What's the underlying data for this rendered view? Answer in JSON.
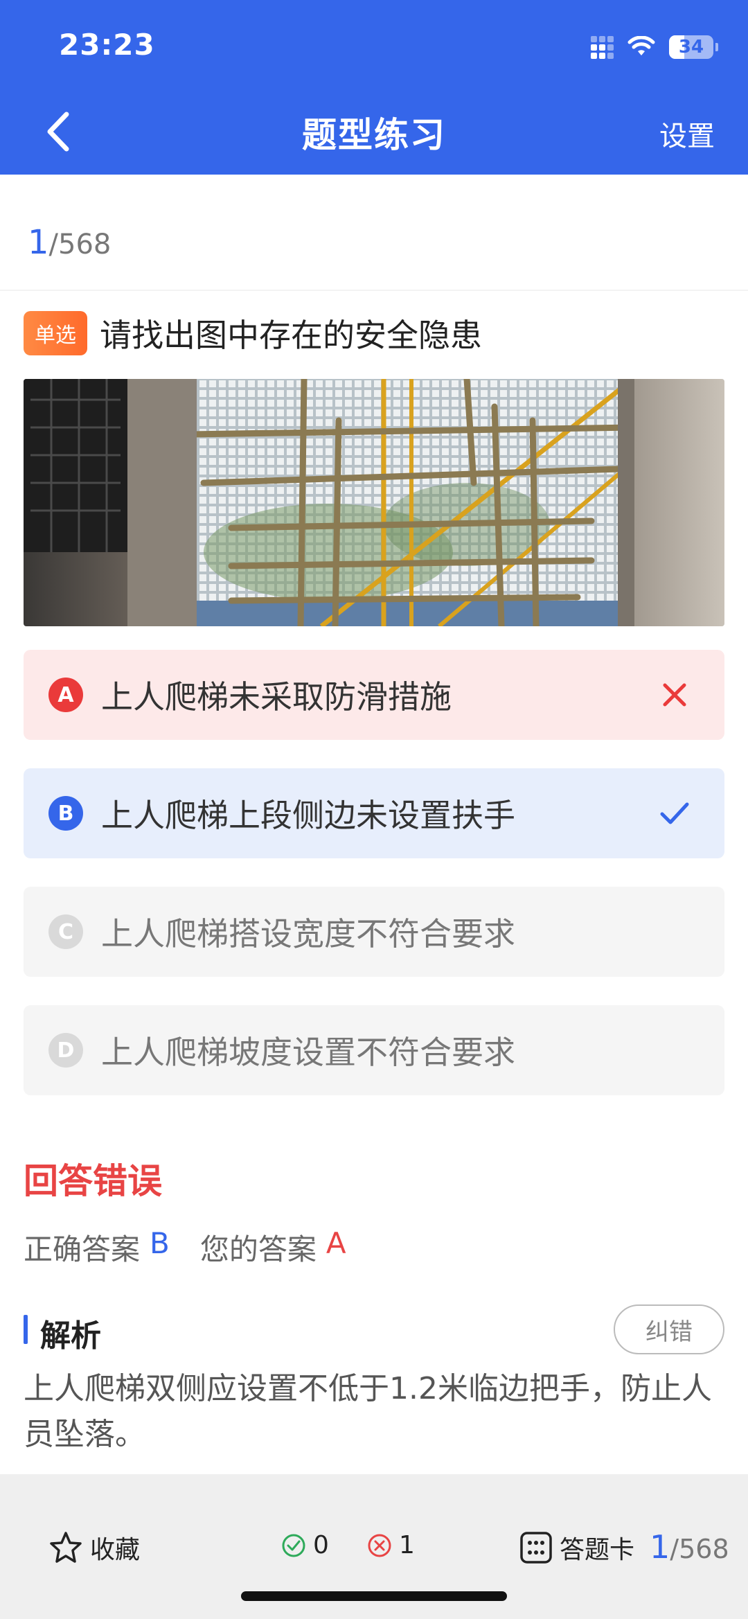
{
  "status": {
    "time": "23:23",
    "battery": "34"
  },
  "header": {
    "title": "题型练习",
    "settings_label": "设置"
  },
  "counter": {
    "current": "1",
    "total": "/568"
  },
  "question": {
    "type_badge": "单选",
    "text": "请找出图中存在的安全隐患"
  },
  "options": [
    {
      "letter": "A",
      "text": "上人爬梯未采取防滑措施",
      "state": "wrong"
    },
    {
      "letter": "B",
      "text": "上人爬梯上段侧边未设置扶手",
      "state": "correct"
    },
    {
      "letter": "C",
      "text": "上人爬梯搭设宽度不符合要求",
      "state": "normal"
    },
    {
      "letter": "D",
      "text": "上人爬梯坡度设置不符合要求",
      "state": "normal"
    }
  ],
  "result": {
    "title": "回答错误",
    "correct_label": "正确答案",
    "correct_answer": "B",
    "your_label": "您的答案",
    "your_answer": "A"
  },
  "analysis": {
    "title": "解析",
    "report_label": "纠错",
    "text": "上人爬梯双侧应设置不低于1.2米临边把手，防止人员坠落。"
  },
  "bottom": {
    "favorite_label": "收藏",
    "correct_count": "0",
    "wrong_count": "1",
    "card_label": "答题卡",
    "progress_current": "1",
    "progress_total": "/568"
  },
  "colors": {
    "primary": "#3566ea",
    "error": "#e84444",
    "badge": "#ff7a35"
  }
}
